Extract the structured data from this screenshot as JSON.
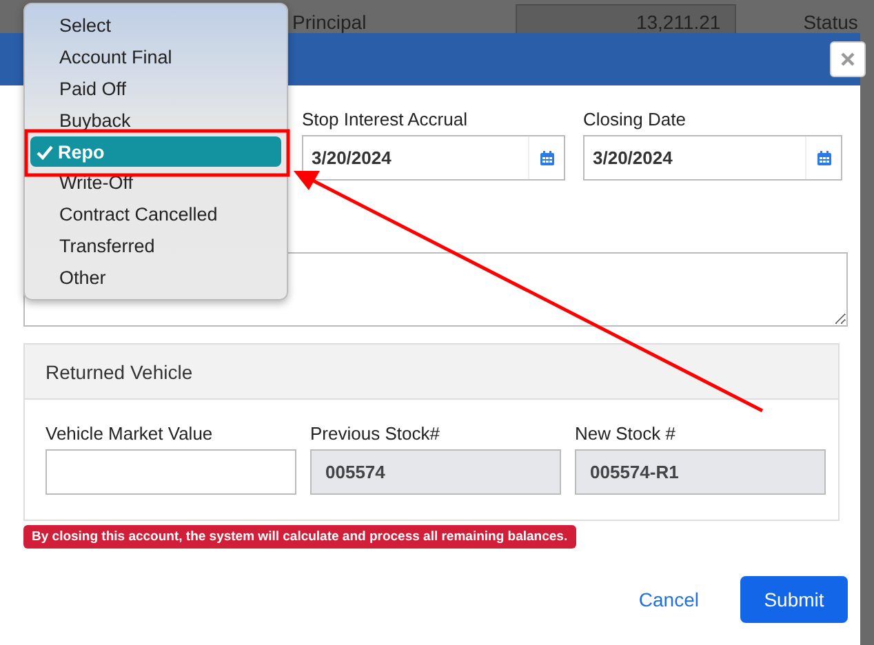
{
  "background": {
    "principal_label": "Principal",
    "principal_amount": "13,211.21",
    "status_label": "Status"
  },
  "dialog": {
    "date_fields": [
      {
        "label": "Stop Interest Accrual",
        "value": "3/20/2024"
      },
      {
        "label": "Closing Date",
        "value": "3/20/2024"
      }
    ],
    "returned_vehicle": {
      "title": "Returned Vehicle",
      "fields": [
        {
          "label": "Vehicle Market Value",
          "disabled": false
        },
        {
          "label": "Previous Stock#",
          "value": "005574",
          "disabled": true
        },
        {
          "label": "New Stock #",
          "value": "005574-R1",
          "disabled": true
        }
      ]
    },
    "alert": "By closing this account, the system will calculate and process all remaining balances.",
    "buttons": [
      {
        "label": "Cancel",
        "kind": "link"
      },
      {
        "label": "Submit",
        "kind": "primary"
      }
    ]
  },
  "dropdown": {
    "options": [
      {
        "label": "Select",
        "selected": false
      },
      {
        "label": "Account Final",
        "selected": false
      },
      {
        "label": "Paid Off",
        "selected": false
      },
      {
        "label": "Buyback",
        "selected": false
      },
      {
        "label": "Repo",
        "selected": true
      },
      {
        "label": "Write-Off",
        "selected": false
      },
      {
        "label": "Contract Cancelled",
        "selected": false
      },
      {
        "label": "Transferred",
        "selected": false
      },
      {
        "label": "Other",
        "selected": false
      }
    ]
  }
}
